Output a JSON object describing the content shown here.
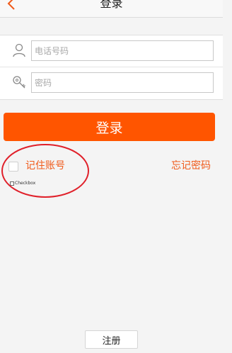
{
  "header": {
    "title": "登录",
    "back_icon": "chevron-left-icon"
  },
  "form": {
    "phone": {
      "icon": "user-icon",
      "placeholder": "电话号码",
      "value": ""
    },
    "password": {
      "icon": "key-icon",
      "placeholder": "密码",
      "value": ""
    }
  },
  "actions": {
    "login_label": "登录",
    "remember_label": "记住账号",
    "forgot_label": "忘记密码",
    "register_label": "注册",
    "debug_checkbox_label": "Checkbox"
  },
  "colors": {
    "accent": "#ff5500",
    "link": "#f05a1a",
    "annotation": "#e0202a"
  }
}
